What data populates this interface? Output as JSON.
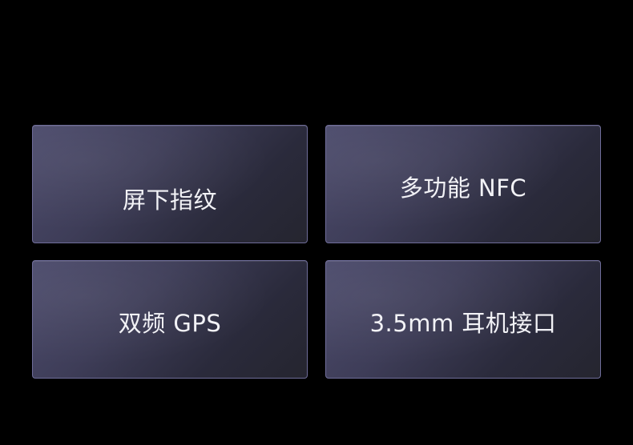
{
  "features": [
    {
      "label": "屏下指纹"
    },
    {
      "label": "多功能 NFC"
    },
    {
      "label": "双频 GPS"
    },
    {
      "label": "3.5mm 耳机接口"
    }
  ],
  "colors": {
    "background": "#000000",
    "card_gradient_start": "#4c4b6c",
    "card_gradient_end": "#25252f",
    "card_border": "#6f6d9a",
    "text": "#f2f2f6"
  }
}
